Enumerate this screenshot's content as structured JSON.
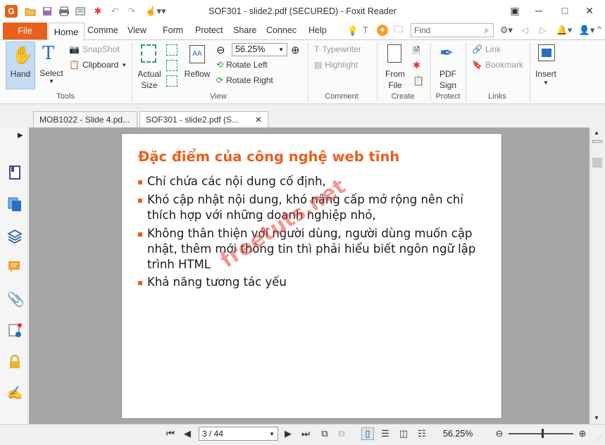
{
  "window": {
    "title": "SOF301 - slide2.pdf (SECURED) - Foxit Reader",
    "app_icon_letter": "G"
  },
  "ribbon_tabs": [
    "File",
    "Home",
    "Comme",
    "View",
    "Form",
    "Protect",
    "Share",
    "Connec",
    "Help"
  ],
  "tell_me_letter": "T",
  "find": {
    "placeholder": "Find"
  },
  "ribbon": {
    "tools": {
      "hand": "Hand",
      "select": "Select",
      "snapshot": "SnapShot",
      "clipboard": "Clipboard",
      "group": "Tools"
    },
    "view": {
      "actual_size": [
        "Actual",
        "Size"
      ],
      "reflow": "Reflow",
      "zoom_value": "56.25%",
      "rotate_left": "Rotate Left",
      "rotate_right": "Rotate Right",
      "group": "View"
    },
    "comment": {
      "typewriter": "Typewriter",
      "highlight": "Highlight",
      "group": "Comment"
    },
    "create": {
      "from_file": [
        "From",
        "File"
      ],
      "group": "Create"
    },
    "protect": {
      "pdf_sign": [
        "PDF",
        "Sign"
      ],
      "group": "Protect"
    },
    "links": {
      "link": "Link",
      "bookmark": "Bookmark",
      "group": "Links"
    },
    "insert": {
      "insert": "Insert"
    }
  },
  "doc_tabs": [
    {
      "label": "MOB1022 - Slide 4.pd...",
      "active": false
    },
    {
      "label": "SOF301 - slide2.pdf (S...",
      "active": true
    }
  ],
  "slide": {
    "title": "Đặc điểm của công nghệ web tĩnh",
    "bullets": [
      [
        "Chỉ chứa các nội dung cố định,"
      ],
      [
        "Khó cập nhật nội dung, khó nâng cấp mở rộng nên chỉ",
        "thích hợp với những doanh nghiệp nhỏ,"
      ],
      [
        "Không thân thiện với người dùng, người dùng muốn cập",
        "nhật, thêm mới thông tin thì phải hiểu biết ngôn ngữ lập",
        "trình HTML"
      ],
      [
        "Khả năng tương tác yếu"
      ]
    ],
    "watermark": "freetuts.net"
  },
  "status": {
    "page_value": "3 / 44",
    "zoom": "56.25%"
  },
  "colors": {
    "accent": "#e8601c",
    "doc_background": "#a6a6a6",
    "hand_active": "#c5dcf3"
  }
}
